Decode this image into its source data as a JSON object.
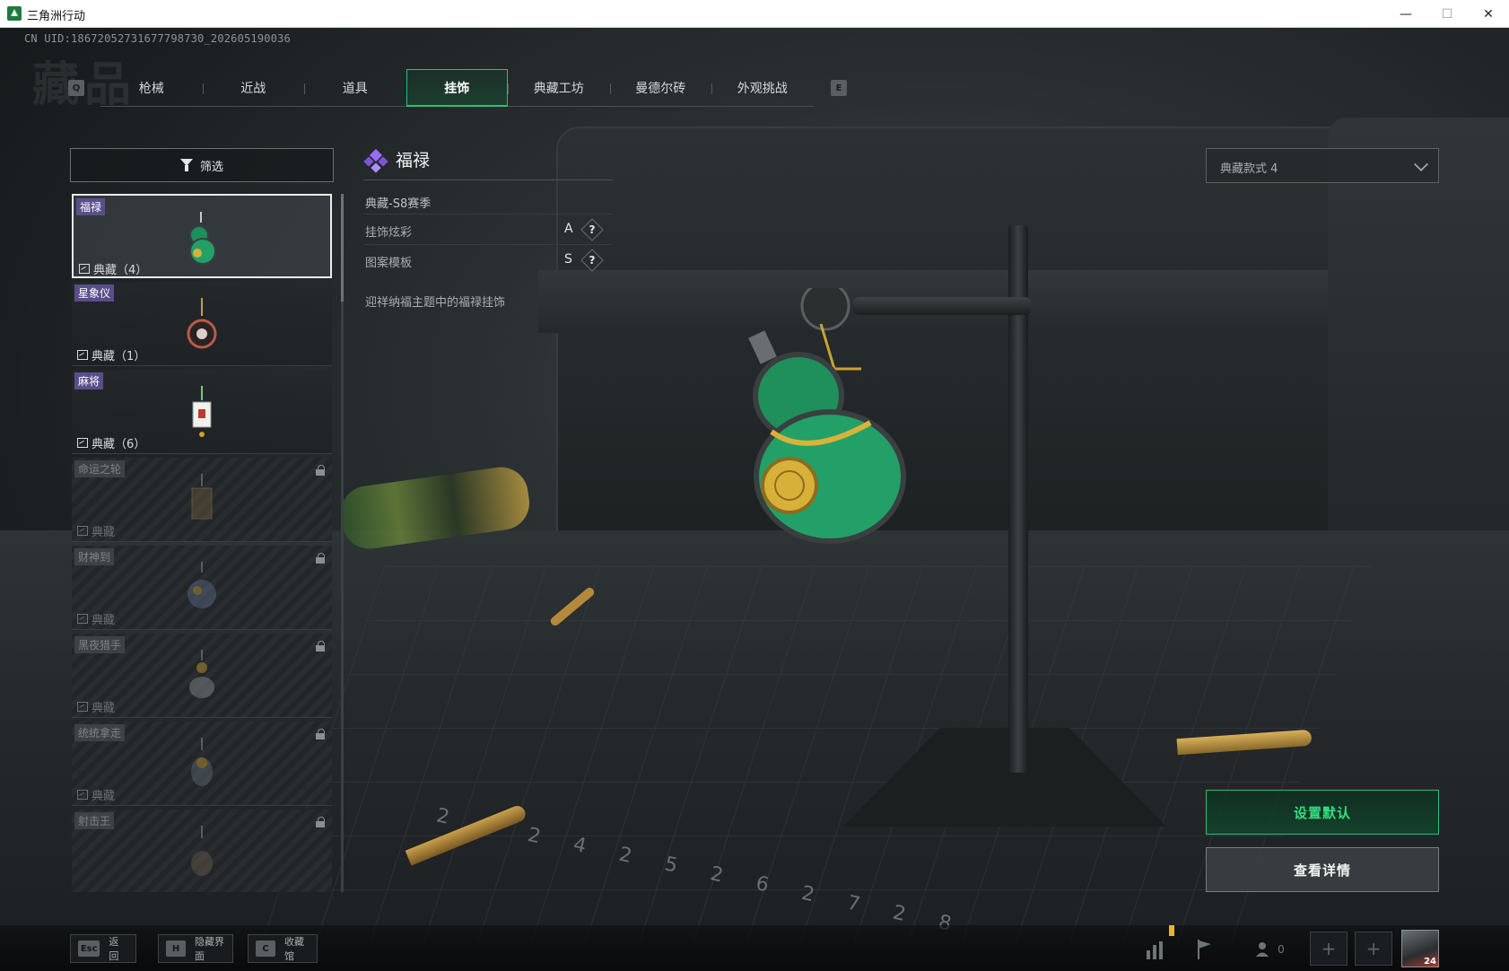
{
  "window": {
    "title": "三角洲行动",
    "min_glyph": "—",
    "max_glyph": "☐",
    "close_glyph": "✕"
  },
  "uid_text": "CN UID:18672052731677798730_202605190036",
  "watermark": "藏品",
  "tabs": {
    "prev_key": "Q",
    "next_key": "E",
    "items": [
      {
        "label": "枪械"
      },
      {
        "label": "近战"
      },
      {
        "label": "道具"
      },
      {
        "label": "挂饰",
        "active": true
      },
      {
        "label": "典藏工坊"
      },
      {
        "label": "曼德尔砖"
      },
      {
        "label": "外观挑战"
      }
    ]
  },
  "filter": {
    "label": "筛选"
  },
  "charms": [
    {
      "tag": "福禄",
      "count": "典藏（4）",
      "state": "selected",
      "icon": "gourd-charm-icon"
    },
    {
      "tag": "星象仪",
      "count": "典藏（1）",
      "state": "owned",
      "icon": "astrolabe-charm-icon"
    },
    {
      "tag": "麻将",
      "count": "典藏（6）",
      "state": "owned",
      "icon": "mahjong-charm-icon"
    },
    {
      "tag": "命运之轮",
      "count": "典藏",
      "state": "locked",
      "icon": "fortune-wheel-charm-icon"
    },
    {
      "tag": "财神到",
      "count": "典藏",
      "state": "locked",
      "icon": "fortune-god-charm-icon"
    },
    {
      "tag": "黑夜猎手",
      "count": "典藏",
      "state": "locked",
      "icon": "night-hunter-charm-icon"
    },
    {
      "tag": "统统拿走",
      "count": "典藏",
      "state": "locked",
      "icon": "take-all-charm-icon"
    },
    {
      "tag": "射击王",
      "count": "",
      "state": "locked",
      "icon": "shooting-king-charm-icon"
    }
  ],
  "detail": {
    "name": "福禄",
    "rarity_color": "#9a6bff",
    "season": "典藏-S8赛季",
    "rows": [
      {
        "label": "挂饰炫彩",
        "grade": "A",
        "help": "?"
      },
      {
        "label": "图案模板",
        "grade": "S",
        "help": "?"
      }
    ],
    "description": "迎祥纳福主题中的福禄挂饰"
  },
  "variant_select": {
    "value": "典藏款式 4"
  },
  "actions": {
    "set_default": "设置默认",
    "view_details": "查看详情"
  },
  "scene": {
    "ruler_marks": [
      "23",
      "24",
      "25",
      "26",
      "27",
      "28"
    ]
  },
  "bottom_bar": {
    "hotkeys": [
      {
        "key": "Esc",
        "label": "返回"
      },
      {
        "key": "H",
        "label": "隐藏界面"
      },
      {
        "key": "C",
        "label": "收藏馆"
      }
    ],
    "team_count": "0",
    "player_level": "24"
  },
  "colors": {
    "accent_green": "#2fbf72",
    "tag_purple": "#5a4e8a",
    "warning_yellow": "#e5b62c"
  }
}
